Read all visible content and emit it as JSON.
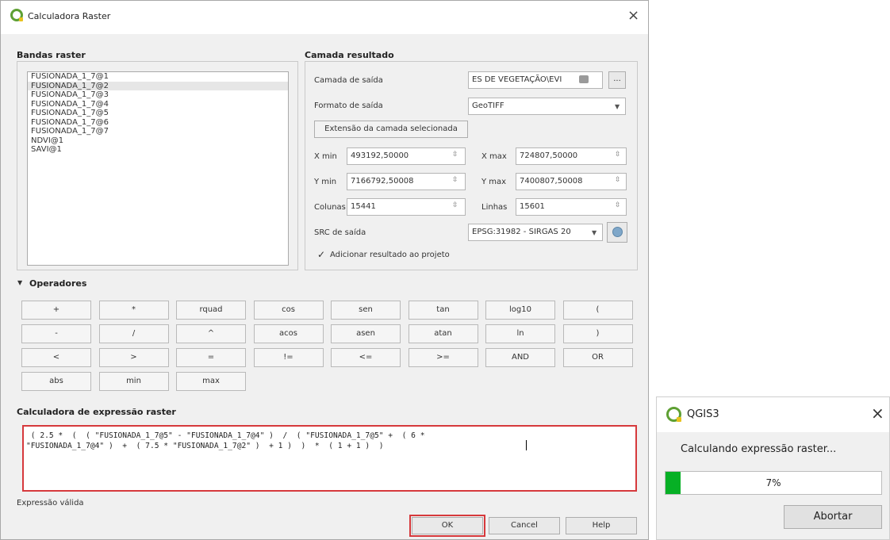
{
  "main_dialog": {
    "title": "Calculadora Raster",
    "close_symbol": "×",
    "bands": {
      "title": "Bandas raster",
      "items": [
        "FUSIONADA_1_7@1",
        "FUSIONADA_1_7@2",
        "FUSIONADA_1_7@3",
        "FUSIONADA_1_7@4",
        "FUSIONADA_1_7@5",
        "FUSIONADA_1_7@6",
        "FUSIONADA_1_7@7",
        "NDVI@1",
        "SAVI@1"
      ]
    },
    "result": {
      "title": "Camada resultado",
      "output_layer_label": "Camada de saída",
      "output_layer_value": "ES DE VEGETAÇÃO\\EVI",
      "browse_label": "...",
      "format_label": "Formato de saída",
      "format_value": "GeoTIFF",
      "extent_button": "Extensão da camada selecionada",
      "xmin_label": "X min",
      "xmin_value": "493192,50000",
      "xmax_label": "X max",
      "xmax_value": "724807,50000",
      "ymin_label": "Y min",
      "ymin_value": "7166792,50008",
      "ymax_label": "Y max",
      "ymax_value": "7400807,50008",
      "cols_label": "Colunas",
      "cols_value": "15441",
      "rows_label": "Linhas",
      "rows_value": "15601",
      "crs_label": "SRC de saída",
      "crs_value": "EPSG:31982 - SIRGAS 20",
      "add_result_label": "Adicionar resultado ao projeto",
      "add_result_checked": true
    },
    "operators": {
      "title": "Operadores",
      "rows": [
        [
          "+",
          "*",
          "rquad",
          "cos",
          "sen",
          "tan",
          "log10",
          "("
        ],
        [
          "-",
          "/",
          "^",
          "acos",
          "asen",
          "atan",
          "ln",
          ")"
        ],
        [
          "<",
          ">",
          "=",
          "!=",
          "<=",
          ">=",
          "AND",
          "OR"
        ],
        [
          "abs",
          "min",
          "max"
        ]
      ]
    },
    "expression": {
      "title": "Calculadora de expressão raster",
      "line1": " ( 2.5 *  (  ( \"FUSIONADA_1_7@5\" - \"FUSIONADA_1_7@4\" )  /  ( \"FUSIONADA_1_7@5\" +  ( 6 *",
      "line2": "\"FUSIONADA_1_7@4\" )  +  ( 7.5 * \"FUSIONADA_1_7@2\" )  + 1 )  )  *  ( 1 + 1 )  )",
      "status": "Expressão válida"
    },
    "buttons": {
      "ok": "OK",
      "cancel": "Cancel",
      "help": "Help"
    },
    "colors": {
      "highlight": "#d6393c",
      "qgis_green": "#5ea033"
    }
  },
  "progress_dialog": {
    "title": "QGIS3",
    "close_symbol": "×",
    "message": "Calculando expressão raster...",
    "progress_percent": 7,
    "progress_text": "7%",
    "abort_label": "Abortar",
    "colors": {
      "progress_fill": "#06b025"
    }
  }
}
